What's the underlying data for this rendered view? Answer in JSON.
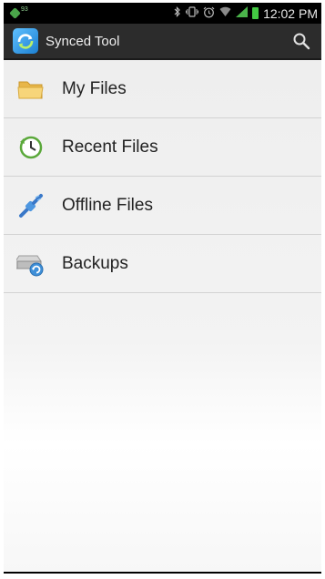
{
  "status_bar": {
    "notification_number": "93",
    "time": "12:02 PM"
  },
  "action_bar": {
    "title": "Synced Tool"
  },
  "menu": {
    "items": [
      {
        "label": "My Files",
        "icon": "folder-icon"
      },
      {
        "label": "Recent Files",
        "icon": "clock-icon"
      },
      {
        "label": "Offline Files",
        "icon": "offline-icon"
      },
      {
        "label": "Backups",
        "icon": "backup-icon"
      }
    ]
  },
  "colors": {
    "action_bar": "#2c2c2c",
    "status_bar": "#000000",
    "list_background": "#eeeeee",
    "divider": "#d2d2d2"
  }
}
